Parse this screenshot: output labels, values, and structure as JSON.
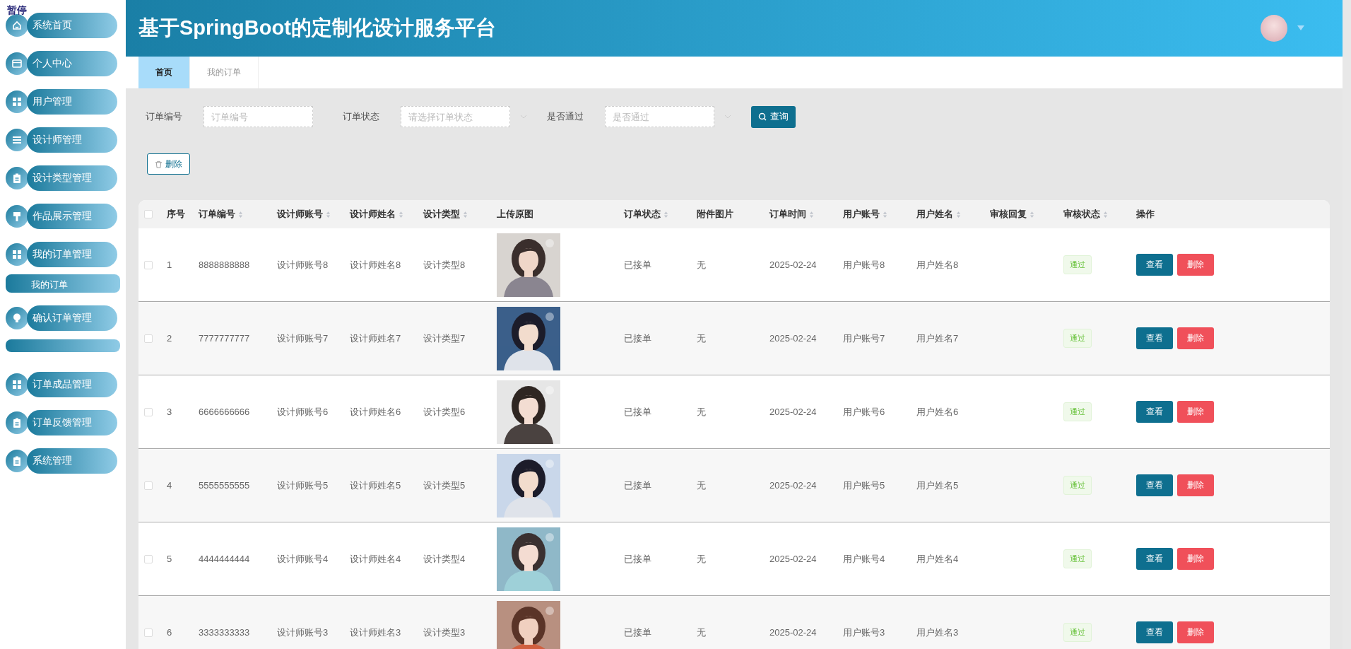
{
  "overlay_label": "暂停",
  "sidebar": {
    "items": [
      {
        "label": "系统首页",
        "kind": "home"
      },
      {
        "label": "个人中心",
        "kind": "card"
      },
      {
        "label": "用户管理",
        "kind": "grid"
      },
      {
        "label": "设计师管理",
        "kind": "list"
      },
      {
        "label": "设计类型管理",
        "kind": "clipboard"
      },
      {
        "label": "作品展示管理",
        "kind": "brush"
      },
      {
        "label": "我的订单管理",
        "kind": "grid",
        "children": [
          {
            "kind": "label",
            "label": "我的订单"
          }
        ]
      },
      {
        "label": "确认订单管理",
        "kind": "bulb",
        "children": [
          {
            "kind": "bar"
          }
        ]
      },
      {
        "label": "订单成品管理",
        "kind": "grid"
      },
      {
        "label": "订单反馈管理",
        "kind": "clipboard"
      },
      {
        "label": "系统管理",
        "kind": "clipboard"
      }
    ]
  },
  "header": {
    "title": "基于SpringBoot的定制化设计服务平台"
  },
  "tabs": [
    {
      "label": "首页",
      "selected": true
    },
    {
      "label": "我的订单",
      "selected": false
    }
  ],
  "filters": [
    {
      "label": "订单编号",
      "kind": "input",
      "placeholder": "订单编号"
    },
    {
      "label": "订单状态",
      "kind": "select",
      "placeholder": "请选择订单状态"
    },
    {
      "label": "是否通过",
      "kind": "select",
      "placeholder": "是否通过"
    }
  ],
  "search_button": "查询",
  "delete_button": "删除",
  "table": {
    "header_checked": false,
    "columns": [
      {
        "label": "序号",
        "sortable": false
      },
      {
        "label": "订单编号",
        "sortable": true
      },
      {
        "label": "设计师账号",
        "sortable": true
      },
      {
        "label": "设计师姓名",
        "sortable": true
      },
      {
        "label": "设计类型",
        "sortable": true
      },
      {
        "label": "上传原图",
        "sortable": false
      },
      {
        "label": "订单状态",
        "sortable": true
      },
      {
        "label": "附件图片",
        "sortable": false
      },
      {
        "label": "订单时间",
        "sortable": true
      },
      {
        "label": "用户账号",
        "sortable": true
      },
      {
        "label": "用户姓名",
        "sortable": true
      },
      {
        "label": "审核回复",
        "sortable": true
      },
      {
        "label": "审核状态",
        "sortable": true
      },
      {
        "label": "操作",
        "sortable": false
      }
    ],
    "rows": [
      {
        "checked": false,
        "index": "1",
        "order_no": "8888888888",
        "designer_account": "设计师账号8",
        "designer_name": "设计师姓名8",
        "design_type": "设计类型8",
        "order_status": "已接单",
        "attachment": "无",
        "order_time": "2025-02-24",
        "user_account": "用户账号8",
        "user_name": "用户姓名8",
        "review_status": "通过",
        "actions": [
          "查看",
          "删除"
        ]
      },
      {
        "checked": false,
        "index": "2",
        "order_no": "7777777777",
        "designer_account": "设计师账号7",
        "designer_name": "设计师姓名7",
        "design_type": "设计类型7",
        "order_status": "已接单",
        "attachment": "无",
        "order_time": "2025-02-24",
        "user_account": "用户账号7",
        "user_name": "用户姓名7",
        "review_status": "通过",
        "actions": [
          "查看",
          "删除"
        ]
      },
      {
        "checked": false,
        "index": "3",
        "order_no": "6666666666",
        "designer_account": "设计师账号6",
        "designer_name": "设计师姓名6",
        "design_type": "设计类型6",
        "order_status": "已接单",
        "attachment": "无",
        "order_time": "2025-02-24",
        "user_account": "用户账号6",
        "user_name": "用户姓名6",
        "review_status": "通过",
        "actions": [
          "查看",
          "删除"
        ]
      },
      {
        "checked": false,
        "index": "4",
        "order_no": "5555555555",
        "designer_account": "设计师账号5",
        "designer_name": "设计师姓名5",
        "design_type": "设计类型5",
        "order_status": "已接单",
        "attachment": "无",
        "order_time": "2025-02-24",
        "user_account": "用户账号5",
        "user_name": "用户姓名5",
        "review_status": "通过",
        "actions": [
          "查看",
          "删除"
        ]
      },
      {
        "checked": false,
        "index": "5",
        "order_no": "4444444444",
        "designer_account": "设计师账号4",
        "designer_name": "设计师姓名4",
        "design_type": "设计类型4",
        "order_status": "已接单",
        "attachment": "无",
        "order_time": "2025-02-24",
        "user_account": "用户账号4",
        "user_name": "用户姓名4",
        "review_status": "通过",
        "actions": [
          "查看",
          "删除"
        ]
      },
      {
        "checked": false,
        "index": "6",
        "order_no": "3333333333",
        "designer_account": "设计师账号3",
        "designer_name": "设计师姓名3",
        "design_type": "设计类型3",
        "order_status": "已接单",
        "attachment": "无",
        "order_time": "2025-02-24",
        "user_account": "用户账号3",
        "user_name": "用户姓名3",
        "review_status": "通过",
        "actions": [
          "查看",
          "删除"
        ]
      }
    ]
  }
}
